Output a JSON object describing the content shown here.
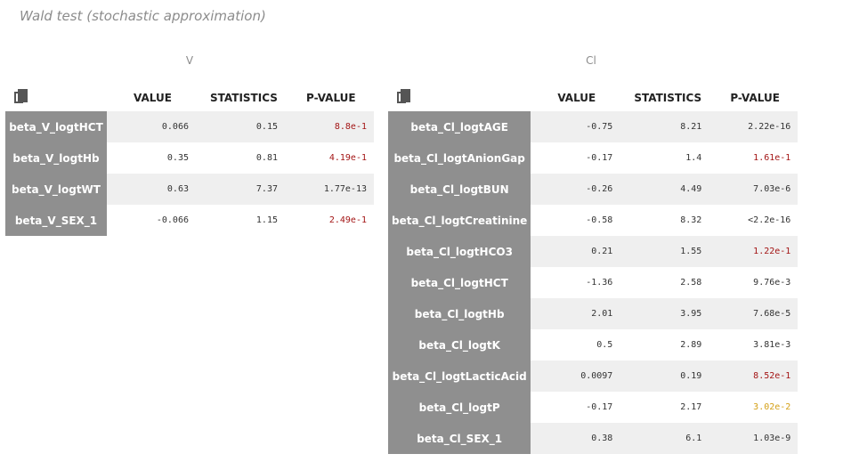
{
  "title": "Wald test (stochastic approximation)",
  "colors": {
    "rowname_bg": "#8f8f8f",
    "stripe": "#efefef",
    "pvalue_red": "#a31515",
    "pvalue_gold": "#d4a017"
  },
  "tables": {
    "v": {
      "group_label": "V",
      "headers": [
        "VALUE",
        "STATISTICS",
        "P-VALUE"
      ],
      "rows": [
        {
          "name": "beta_V_logtHCT",
          "value": "0.066",
          "statistics": "0.15",
          "pvalue": "8.8e-1",
          "pcolor": "red"
        },
        {
          "name": "beta_V_logtHb",
          "value": "0.35",
          "statistics": "0.81",
          "pvalue": "4.19e-1",
          "pcolor": "red"
        },
        {
          "name": "beta_V_logtWT",
          "value": "0.63",
          "statistics": "7.37",
          "pvalue": "1.77e-13",
          "pcolor": "plain"
        },
        {
          "name": "beta_V_SEX_1",
          "value": "-0.066",
          "statistics": "1.15",
          "pvalue": "2.49e-1",
          "pcolor": "red"
        }
      ]
    },
    "cl": {
      "group_label": "Cl",
      "headers": [
        "VALUE",
        "STATISTICS",
        "P-VALUE"
      ],
      "rows": [
        {
          "name": "beta_Cl_logtAGE",
          "value": "-0.75",
          "statistics": "8.21",
          "pvalue": "2.22e-16",
          "pcolor": "plain"
        },
        {
          "name": "beta_Cl_logtAnionGap",
          "value": "-0.17",
          "statistics": "1.4",
          "pvalue": "1.61e-1",
          "pcolor": "red"
        },
        {
          "name": "beta_Cl_logtBUN",
          "value": "-0.26",
          "statistics": "4.49",
          "pvalue": "7.03e-6",
          "pcolor": "plain"
        },
        {
          "name": "beta_Cl_logtCreatinine",
          "value": "-0.58",
          "statistics": "8.32",
          "pvalue": "<2.2e-16",
          "pcolor": "plain"
        },
        {
          "name": "beta_Cl_logtHCO3",
          "value": "0.21",
          "statistics": "1.55",
          "pvalue": "1.22e-1",
          "pcolor": "red"
        },
        {
          "name": "beta_Cl_logtHCT",
          "value": "-1.36",
          "statistics": "2.58",
          "pvalue": "9.76e-3",
          "pcolor": "plain"
        },
        {
          "name": "beta_Cl_logtHb",
          "value": "2.01",
          "statistics": "3.95",
          "pvalue": "7.68e-5",
          "pcolor": "plain"
        },
        {
          "name": "beta_Cl_logtK",
          "value": "0.5",
          "statistics": "2.89",
          "pvalue": "3.81e-3",
          "pcolor": "plain"
        },
        {
          "name": "beta_Cl_logtLacticAcid",
          "value": "0.0097",
          "statistics": "0.19",
          "pvalue": "8.52e-1",
          "pcolor": "red"
        },
        {
          "name": "beta_Cl_logtP",
          "value": "-0.17",
          "statistics": "2.17",
          "pvalue": "3.02e-2",
          "pcolor": "gold"
        },
        {
          "name": "beta_Cl_SEX_1",
          "value": "0.38",
          "statistics": "6.1",
          "pvalue": "1.03e-9",
          "pcolor": "plain"
        }
      ]
    }
  }
}
